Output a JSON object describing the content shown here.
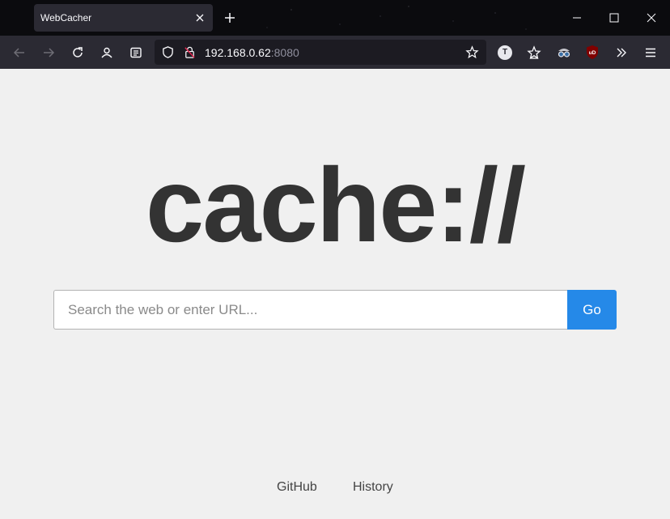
{
  "browser": {
    "tab": {
      "title": "WebCacher"
    },
    "url": {
      "host": "192.168.0.62",
      "port": ":8080"
    },
    "extension_badge_letter": "T",
    "ublock_label": "uD"
  },
  "page": {
    "logo": "cache://",
    "search": {
      "placeholder": "Search the web or enter URL...",
      "value": "",
      "button_label": "Go"
    },
    "footer_links": [
      "GitHub",
      "History"
    ]
  },
  "colors": {
    "accent": "#2589e8",
    "logo_text": "#333333",
    "page_bg": "#f0f0f0",
    "toolbar_bg": "#2b2a33"
  },
  "icons": [
    "close-icon",
    "plus-icon",
    "minimize-icon",
    "maximize-icon",
    "window-close-icon",
    "back-arrow-icon",
    "forward-arrow-icon",
    "reload-icon",
    "account-icon",
    "reader-icon",
    "shield-icon",
    "insecure-lock-icon",
    "star-icon",
    "extension-star-icon",
    "spy-glasses-icon",
    "ublock-icon",
    "overflow-chevrons-icon",
    "hamburger-menu-icon"
  ]
}
